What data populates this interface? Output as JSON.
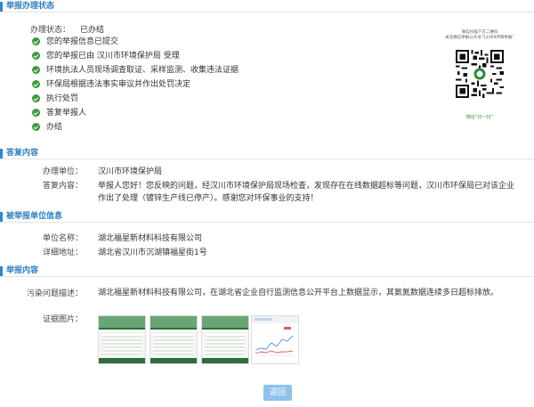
{
  "sections": {
    "status": "举报办理状态",
    "reply": "答复内容",
    "unit_info": "被举报单位信息",
    "report": "举报内容"
  },
  "status": {
    "label": "办理状态：",
    "value": "已办结",
    "steps": [
      "您的举报信息已提交",
      "您的举报已由 汉川市环境保护局 受理",
      "环境执法人员现场调查取证、采样监测、收集违法证据",
      "环保局根据违法事实审议并作出处罚决定",
      "执行处罚",
      "答复举报人",
      "办结"
    ]
  },
  "qr": {
    "caption_line1": "微信扫描下方二维码",
    "caption_line2": "关注微信举报公众号“12369环保举报”",
    "bottom": "微信“扫一扫”"
  },
  "reply": {
    "unit_label": "办理单位：",
    "unit_value": "汉川市环境保护局",
    "content_label": "答复内容：",
    "content_value": "举报人您好！您反映的问题，经汉川市环境保护局现场检查，发现存在在线数据超标等问题，汉川市环保局已对该企业作出了处理（镀锌生产线已停产）。感谢您对环保事业的支持！"
  },
  "unit_info": {
    "name_label": "单位名称：",
    "name_value": "湖北福星新材料科技有限公司",
    "addr_label": "详细地址：",
    "addr_value": "湖北省汉川市沉湖镇福星街1号"
  },
  "report": {
    "desc_label": "污染问题描述：",
    "desc_value": "湖北福星新材料科技有限公司，在湖北省企业自行监测信息公开平台上数据显示，其氨氮数据连续多日超标排放。",
    "images_label": "证据图片：",
    "images": [
      "evidence-image-1",
      "evidence-image-2",
      "evidence-image-3",
      "evidence-image-4"
    ]
  },
  "back_button": "返回",
  "colors": {
    "accent": "#2a8bd0",
    "check": "#3c9b3a",
    "button": "#8fc2ea"
  }
}
